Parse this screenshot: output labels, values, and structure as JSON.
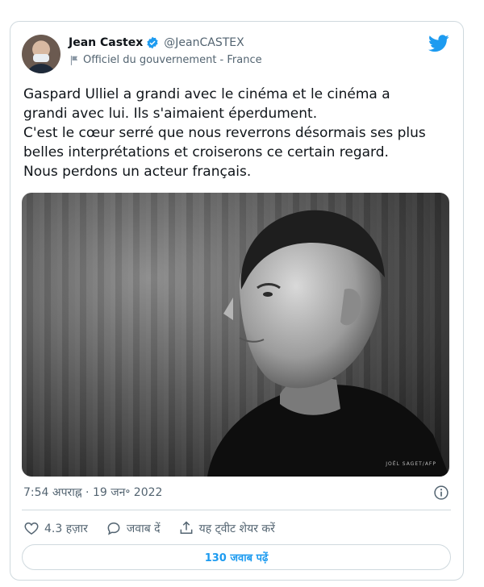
{
  "author": {
    "name": "Jean Castex",
    "handle": "@JeanCASTEX",
    "label": "Officiel du gouvernement - France",
    "verified_color": "#1d9bf0"
  },
  "brand_icon": "twitter-bird-icon",
  "tweet": {
    "lines": [
      "Gaspard Ulliel a grandi avec le cinéma et le cinéma a",
      "grandi avec lui. Ils s'aimaient éperdument.",
      "C'est le cœur serré que nous reverrons désormais ses plus",
      "belles interprétations et croiserons ce certain regard.",
      "Nous perdons un acteur français."
    ]
  },
  "photo": {
    "credit": "JOËL SAGET/AFP"
  },
  "timestamp": "7:54 अपराह्न · 19 जन॰ 2022",
  "actions": {
    "like_count": "4.3 हज़ार",
    "reply_label": "जवाब दें",
    "share_label": "यह ट्वीट शेयर करें"
  },
  "replies_button": "130 जवाब पढ़ें",
  "colors": {
    "accent": "#1d9bf0",
    "text": "#0f1419",
    "muted": "#536471",
    "border": "#cfd9de"
  }
}
